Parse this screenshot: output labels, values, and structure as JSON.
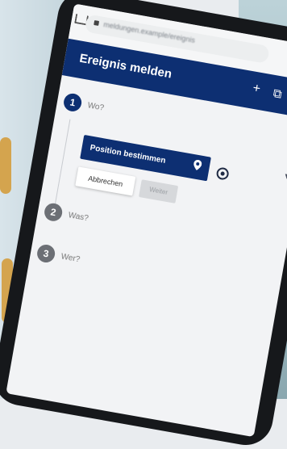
{
  "browser": {
    "url": "meldungen.example/ereignis",
    "status_icons": "▾ ◢ ▮"
  },
  "header": {
    "title": "Ereignis melden",
    "plus_label": "+",
    "tab_icon_label": "⧉"
  },
  "steps": [
    {
      "number": "1",
      "label": "Wo?"
    },
    {
      "number": "2",
      "label": "Was?"
    },
    {
      "number": "3",
      "label": "Wer?"
    }
  ],
  "location_step": {
    "primary_button": "Position bestimmen",
    "cancel_button": "Abbrechen",
    "ok_button": "Weiter"
  },
  "colors": {
    "header": "#0d2f72",
    "step_active": "#0d2f72",
    "step_inactive": "#6c6f75"
  }
}
